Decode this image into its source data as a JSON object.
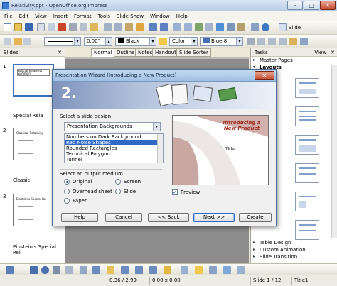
{
  "window": {
    "title": "Relativity.ppt - OpenOffice.org Impress"
  },
  "menu": [
    "File",
    "Edit",
    "View",
    "Insert",
    "Format",
    "Tools",
    "Slide Show",
    "Window",
    "Help"
  ],
  "toolbar": {
    "slide_button": "Slide",
    "line_width": "0.00\"",
    "line_color": "Black",
    "area_style": "Color",
    "area_color": "Blue 8"
  },
  "slides_pane": {
    "title": "Slides",
    "slides": [
      {
        "number": "1",
        "label": "Special Rela",
        "thumb_title": "Special Relativity Summary"
      },
      {
        "number": "2",
        "label": "Classic",
        "thumb_title": "Classical Relativity"
      },
      {
        "number": "3",
        "label": "Einstein's Special Rel",
        "thumb_title": "Einstein's Special Rel"
      }
    ]
  },
  "view_tabs": [
    "Normal",
    "Outline",
    "Notes",
    "Handout",
    "Slide Sorter"
  ],
  "tasks_pane": {
    "title": "Tasks",
    "view_menu": "View",
    "sections_top": [
      "Master Pages",
      "Layouts"
    ],
    "sections_bottom": [
      "Table Design",
      "Custom Animation",
      "Slide Transition"
    ]
  },
  "dialog": {
    "title": "Presentation Wizard (Introducing a New Product)",
    "step": "2.",
    "design_label": "Select a slide design",
    "design_category": "Presentation Backgrounds",
    "design_options": [
      "Numbers on Dark Background",
      "Red Noise Shapes",
      "Rounded Rectangles",
      "Technical Polygon",
      "Tunnel"
    ],
    "design_selected": "Red Noise Shapes",
    "output_label": "Select an output medium",
    "media": [
      "Original",
      "Screen",
      "Overhead sheet",
      "Slide",
      "Paper"
    ],
    "media_selected": "Original",
    "preview_title": "Introducing a New Product",
    "preview_subtitle": "Title",
    "preview_checkbox": "Preview",
    "buttons": {
      "help": "Help",
      "cancel": "Cancel",
      "back": "<< Back",
      "next": "Next >>",
      "create": "Create"
    }
  },
  "status": {
    "position": "0.36 / 2.99",
    "size": "0.00 x 0.00",
    "slide": "Slide 1 / 12",
    "layout": "Title1"
  }
}
